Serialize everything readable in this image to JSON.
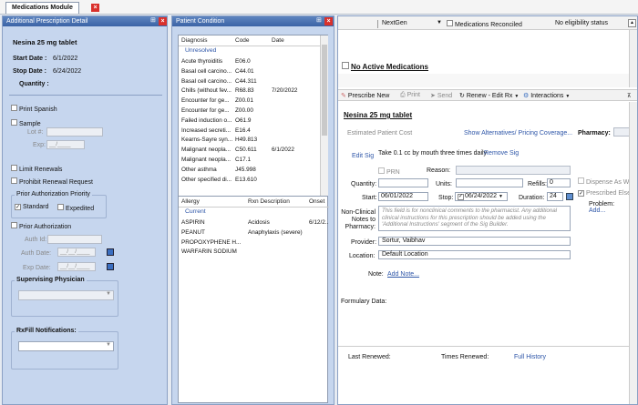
{
  "module_tab": {
    "label": "Medications Module"
  },
  "left_panel": {
    "title": "Additional Prescription Detail",
    "drug": "Nesina 25 mg tablet",
    "start_label": "Start Date :",
    "start_value": "6/1/2022",
    "stop_label": "Stop Date :",
    "stop_value": "6/24/2022",
    "quantity_label": "Quantity :",
    "print_spanish": "Print Spanish",
    "sample": "Sample",
    "lot_label": "Lot #:",
    "exp_label": "Exp:",
    "exp_value": "__/____",
    "limit_renewals": "Limit Renewals",
    "prohibit_renewal": "Prohibit Renewal Request",
    "prior_auth_priority": "Prior Authorization Priority",
    "standard": "Standard",
    "expedited": "Expedited",
    "prior_authorization": "Prior Authorization",
    "auth_id": "Auth Id:",
    "auth_date": "Auth Date:",
    "auth_date_value": "__/__/____",
    "exp_date": "Exp Date:",
    "exp_date_value": "__/__/____",
    "supervising": "Supervising Physician",
    "rxfill": "RxFill Notifications:"
  },
  "patient_condition": {
    "title": "Patient Condition",
    "headers": [
      "Diagnosis",
      "Code",
      "Date"
    ],
    "group": "Unresolved",
    "rows": [
      [
        "Acute thyroiditis",
        "E06.0",
        ""
      ],
      [
        "Basal cell carcino...",
        "C44.01",
        ""
      ],
      [
        "Basal cell carcino...",
        "C44.311",
        ""
      ],
      [
        "Chills (without fev...",
        "R68.83",
        "7/20/2022"
      ],
      [
        "Encounter for ge...",
        "Z00.01",
        ""
      ],
      [
        "Encounter for ge...",
        "Z00.00",
        ""
      ],
      [
        "Failed induction o...",
        "O61.9",
        ""
      ],
      [
        "Increased secreti...",
        "E16.4",
        ""
      ],
      [
        "Kearns-Sayre syn...",
        "H49.813",
        ""
      ],
      [
        "Malignant neopla...",
        "C50.611",
        "6/1/2022"
      ],
      [
        "Malignant neopla...",
        "C17.1",
        ""
      ],
      [
        "Other asthma",
        "J45.998",
        ""
      ],
      [
        "Other specified di...",
        "E13.610",
        ""
      ]
    ],
    "allergy_headers": [
      "Allergy",
      "Rxn Description",
      "Onset"
    ],
    "allergy_group": "Current",
    "allergies": [
      [
        "ASPIRIN",
        "Acidosis",
        "6/12/2..."
      ],
      [
        "PEANUT",
        "Anaphylaxis (severe)",
        ""
      ],
      [
        "PROPOXYPHENE H...",
        "",
        ""
      ],
      [
        "WARFARIN SODIUM",
        "",
        ""
      ]
    ]
  },
  "right_panel": {
    "nextgen": "NextGen",
    "meds_reconciled": "Medications Reconciled",
    "eligibility": "No eligibility status",
    "no_active": "No Active Medications",
    "toolbar": {
      "prescribe_new": "Prescribe New",
      "print": "Print",
      "send": "Send",
      "renew": "Renew - Edit Rx",
      "interactions": "Interactions"
    },
    "drug": "Nesina 25 mg tablet",
    "estimated_cost": "Estimated Patient Cost",
    "show_alternatives": "Show Alternatives/ Pricing Coverage...",
    "pharmacy_label": "Pharmacy:",
    "edit_sig": "Edit Sig",
    "sig_text": "Take 0.1 cc by mouth three times daily",
    "remove_sig": "Remove Sig",
    "prn": "PRN",
    "reason_label": "Reason:",
    "quantity_label": "Quantity:",
    "units_label": "Units:",
    "refills_label": "Refills:",
    "refills_value": "0",
    "dispense_as_written": "Dispense As Writ",
    "start_label": "Start:",
    "start_value": "06/01/2022",
    "stop_label": "Stop:",
    "stop_value": "06/24/2022",
    "duration_label": "Duration:",
    "duration_value": "24",
    "prescribed_elsewhere": "Prescribed Elsew",
    "problem_label": "Problem:",
    "problem_add": "Add...",
    "nonclinical_label": "Non-Clinical Notes to Pharmacy:",
    "nonclinical_text": "This field is for nonclinical comments to the pharmacist. Any additional clinical instructions for this prescription should be added using the 'Additional Instructions' segment of the Sig Builder.",
    "provider_label": "Provider:",
    "provider_value": "Sortur, Vaibhav",
    "location_label": "Location:",
    "location_value": "Default Location",
    "note_label": "Note:",
    "add_note": "Add Note...",
    "formulary": "Formulary Data:",
    "last_renewed": "Last Renewed:",
    "times_renewed": "Times Renewed:",
    "full_history": "Full History"
  },
  "colors": {
    "accent": "#3b63a6",
    "link": "#1f4fb8",
    "close": "#d9302b"
  }
}
